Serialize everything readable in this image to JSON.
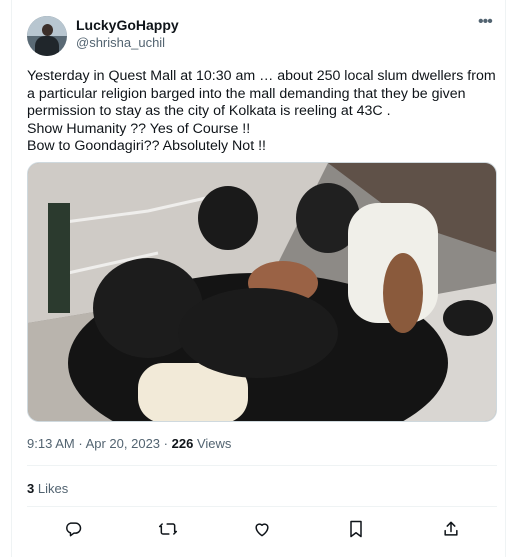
{
  "author": {
    "name": "LuckyGoHappy",
    "handle": "@shrisha_uchil"
  },
  "menu_icon": "more-horizontal-icon",
  "tweet": {
    "text": "Yesterday in Quest Mall at 10:30 am … about 250 local slum dwellers from a particular religion barged into the mall demanding that they be given permission to stay as the city of Kolkata is reeling at 43C .\nShow Humanity ?? Yes of Course !!\nBow to Goondagiri?? Absolutely Not !!"
  },
  "meta": {
    "time": "9:13 AM",
    "separator": "·",
    "date": "Apr 20, 2023",
    "view_count": "226",
    "views_label": "Views"
  },
  "engagement": {
    "likes_count": "3",
    "likes_label": "Likes"
  },
  "actions": [
    {
      "name": "reply-icon"
    },
    {
      "name": "retweet-icon"
    },
    {
      "name": "like-icon"
    },
    {
      "name": "bookmark-icon"
    },
    {
      "name": "share-icon"
    }
  ],
  "colors": {
    "text": "#0f1419",
    "secondary": "#536471",
    "divider": "#eff3f4"
  }
}
